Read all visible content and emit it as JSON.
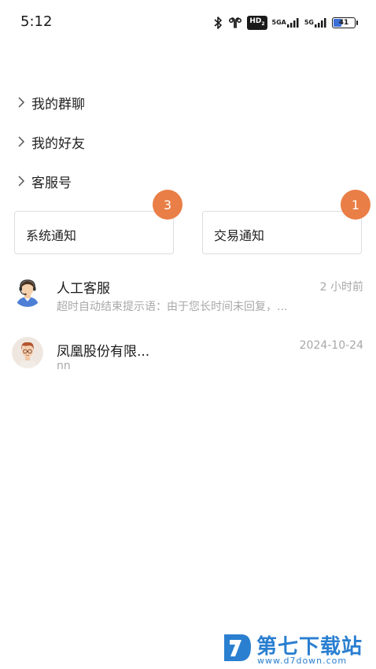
{
  "status_bar": {
    "time": "5:12",
    "hd_label": "HD",
    "hd_sub": "2",
    "network1": "5GA",
    "network2": "5G",
    "battery": "41",
    "battery_level": 0.41,
    "battery_color": "#3b6fd8"
  },
  "groups": [
    {
      "label": "我的群聊"
    },
    {
      "label": "我的好友"
    },
    {
      "label": "客服号"
    }
  ],
  "notices": [
    {
      "label": "系统通知",
      "badge": "3"
    },
    {
      "label": "交易通知",
      "badge": "1"
    }
  ],
  "badge_color": "#e97e46",
  "conversations": [
    {
      "name": "人工客服",
      "time": "2 小时前",
      "preview": "超时自动结束提示语：由于您长时间未回复，...",
      "avatar": "customer-service-agent-avatar"
    },
    {
      "name": "凤凰股份有限...",
      "time": "2024-10-24",
      "preview": "nn",
      "avatar": "user-portrait-avatar"
    }
  ],
  "watermark": {
    "title": "第七下载站",
    "url": "www.d7down.com",
    "color": "#2a7fd0"
  }
}
